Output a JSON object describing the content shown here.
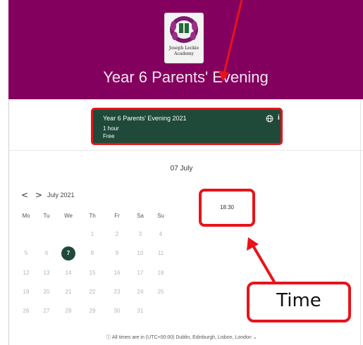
{
  "school": {
    "logo_text_line1": "Joseph Leckie",
    "logo_text_line2": "Academy"
  },
  "header": {
    "title": "Year 6 Parents' Evening",
    "background_color": "#83005f"
  },
  "event": {
    "name": "Year 6 Parents' Evening 2021",
    "duration": "1 hour",
    "price": "Free",
    "card_color": "#1f4a3a"
  },
  "calendar": {
    "date_heading": "07 July",
    "prev_label": "<",
    "next_label": ">",
    "month_label": "July 2021",
    "weekdays": [
      "Mo",
      "Tu",
      "We",
      "Th",
      "Fr",
      "Sa",
      "Su"
    ],
    "weeks": [
      [
        "",
        "",
        "",
        "1",
        "2",
        "3",
        "4"
      ],
      [
        "5",
        "6",
        "7",
        "8",
        "9",
        "10",
        "11"
      ],
      [
        "12",
        "13",
        "14",
        "15",
        "16",
        "17",
        "18"
      ],
      [
        "19",
        "20",
        "21",
        "22",
        "23",
        "24",
        "25"
      ],
      [
        "26",
        "27",
        "28",
        "29",
        "30",
        "31",
        ""
      ]
    ],
    "selected_day": "7"
  },
  "time_slots": [
    "18:30"
  ],
  "annotation": {
    "label": "Time",
    "highlight_color": "#e8131a"
  },
  "footer": {
    "timezone_note": "ⓘ All times are in (UTC+00:00) Dublin, Edinburgh, Lisbon, London ⌄"
  }
}
